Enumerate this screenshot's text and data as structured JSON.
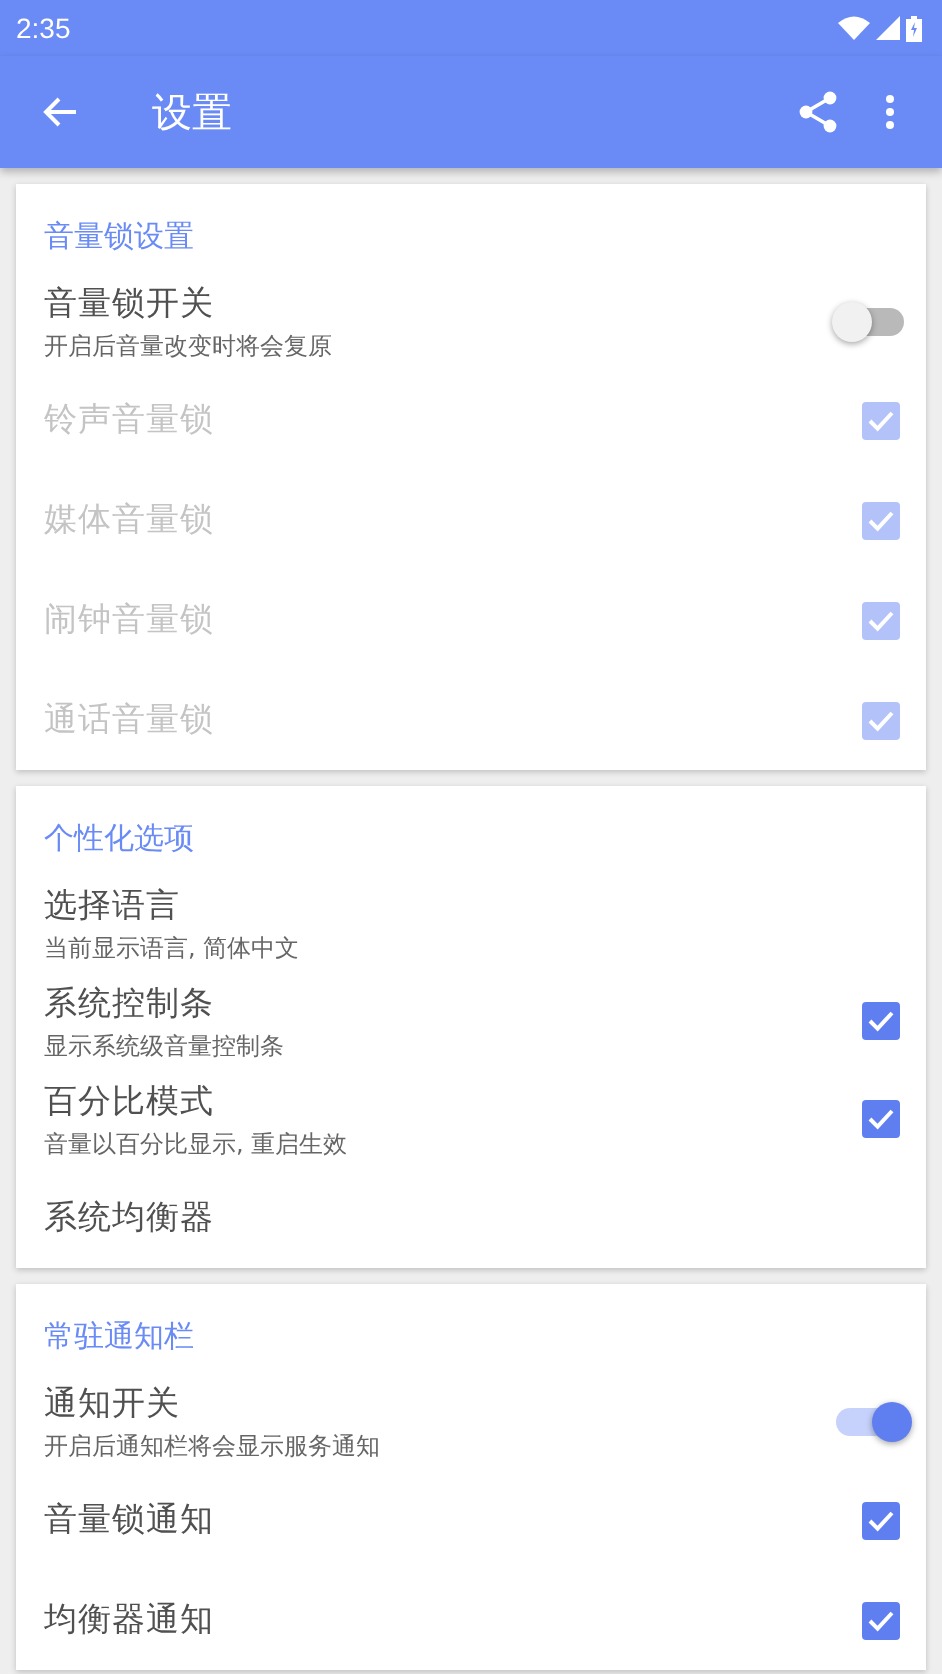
{
  "status_bar": {
    "time": "2:35"
  },
  "app_bar": {
    "title": "设置"
  },
  "sections": [
    {
      "title": "音量锁设置",
      "items": [
        {
          "kind": "switch",
          "title": "音量锁开关",
          "subtitle": "开启后音量改变时将会复原",
          "on": false,
          "disabled": false
        },
        {
          "kind": "checkbox",
          "title": "铃声音量锁",
          "checked": true,
          "disabled": true
        },
        {
          "kind": "checkbox",
          "title": "媒体音量锁",
          "checked": true,
          "disabled": true
        },
        {
          "kind": "checkbox",
          "title": "闹钟音量锁",
          "checked": true,
          "disabled": true
        },
        {
          "kind": "checkbox",
          "title": "通话音量锁",
          "checked": true,
          "disabled": true
        }
      ]
    },
    {
      "title": "个性化选项",
      "items": [
        {
          "kind": "plain",
          "title": "选择语言",
          "subtitle": "当前显示语言, 简体中文",
          "disabled": false
        },
        {
          "kind": "checkbox",
          "title": "系统控制条",
          "subtitle": "显示系统级音量控制条",
          "checked": true,
          "disabled": false
        },
        {
          "kind": "checkbox",
          "title": "百分比模式",
          "subtitle": "音量以百分比显示, 重启生效",
          "checked": true,
          "disabled": false
        },
        {
          "kind": "plain",
          "title": "系统均衡器",
          "disabled": false
        }
      ]
    },
    {
      "title": "常驻通知栏",
      "items": [
        {
          "kind": "switch",
          "title": "通知开关",
          "subtitle": "开启后通知栏将会显示服务通知",
          "on": true,
          "disabled": false
        },
        {
          "kind": "checkbox",
          "title": "音量锁通知",
          "checked": true,
          "disabled": false
        },
        {
          "kind": "checkbox",
          "title": "均衡器通知",
          "checked": true,
          "disabled": false
        }
      ]
    }
  ]
}
